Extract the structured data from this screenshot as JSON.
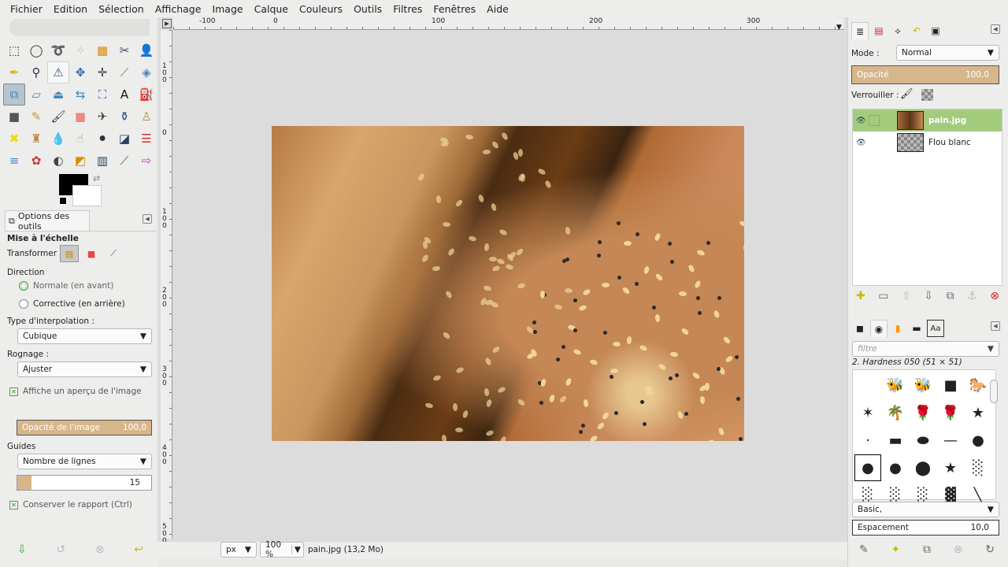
{
  "menu": [
    "Fichier",
    "Edition",
    "Sélection",
    "Affichage",
    "Image",
    "Calque",
    "Couleurs",
    "Outils",
    "Filtres",
    "Fenêtres",
    "Aide"
  ],
  "tools": [
    {
      "name": "rect-select",
      "g": "⬚",
      "c": "#333"
    },
    {
      "name": "ellipse-select",
      "g": "◯",
      "c": "#333"
    },
    {
      "name": "free-select",
      "g": "➰",
      "c": "#888"
    },
    {
      "name": "fuzzy-select",
      "g": "✧",
      "c": "#cc9"
    },
    {
      "name": "color-select",
      "g": "▦",
      "c": "#d80"
    },
    {
      "name": "scissors",
      "g": "✂",
      "c": "#446"
    },
    {
      "name": "foreground-select",
      "g": "👤",
      "c": "#36a"
    },
    {
      "name": "paths",
      "g": "✒",
      "c": "#cb0"
    },
    {
      "name": "color-picker",
      "g": "⚲",
      "c": "#235"
    },
    {
      "name": "measure",
      "g": "⚠",
      "c": "#357"
    },
    {
      "name": "move",
      "g": "✥",
      "c": "#36a"
    },
    {
      "name": "align",
      "g": "✛",
      "c": "#333"
    },
    {
      "name": "crop",
      "g": "⟋",
      "c": "#777"
    },
    {
      "name": "rotate",
      "g": "◈",
      "c": "#48b"
    },
    {
      "name": "scale",
      "g": "⧉",
      "c": "#38b"
    },
    {
      "name": "shear",
      "g": "▱",
      "c": "#48b"
    },
    {
      "name": "perspective",
      "g": "⏏",
      "c": "#48b"
    },
    {
      "name": "flip",
      "g": "⇆",
      "c": "#48b"
    },
    {
      "name": "cage",
      "g": "⛶",
      "c": "#36a"
    },
    {
      "name": "text",
      "g": "A",
      "c": "#111"
    },
    {
      "name": "bucket-fill",
      "g": "⛽",
      "c": "#666"
    },
    {
      "name": "blend",
      "g": "■",
      "c": "#555"
    },
    {
      "name": "pencil",
      "g": "✎",
      "c": "#c93"
    },
    {
      "name": "paintbrush",
      "g": "🖌",
      "c": "#333"
    },
    {
      "name": "eraser",
      "g": "■",
      "c": "#e88"
    },
    {
      "name": "airbrush",
      "g": "✈",
      "c": "#444"
    },
    {
      "name": "ink",
      "g": "⚱",
      "c": "#248"
    },
    {
      "name": "clone",
      "g": "♙",
      "c": "#b84"
    },
    {
      "name": "heal",
      "g": "✖",
      "c": "#ed0"
    },
    {
      "name": "perspective-clone",
      "g": "♜",
      "c": "#b84"
    },
    {
      "name": "blur",
      "g": "💧",
      "c": "#6af"
    },
    {
      "name": "smudge",
      "g": "☝",
      "c": "#c96"
    },
    {
      "name": "dodge-burn",
      "g": "⚫",
      "c": "#333"
    },
    {
      "name": "desaturate",
      "g": "◪",
      "c": "#246"
    },
    {
      "name": "color-balance",
      "g": "☰",
      "c": "#c33"
    },
    {
      "name": "hue-saturation",
      "g": "≡",
      "c": "#48c"
    },
    {
      "name": "colorize",
      "g": "✿",
      "c": "#c33"
    },
    {
      "name": "brightness-contrast",
      "g": "◐",
      "c": "#444"
    },
    {
      "name": "threshold",
      "g": "◩",
      "c": "#d80"
    },
    {
      "name": "levels",
      "g": "▥",
      "c": "#246"
    },
    {
      "name": "curves",
      "g": "⟋",
      "c": "#555"
    },
    {
      "name": "invert",
      "g": "⇨",
      "c": "#c3c"
    }
  ],
  "tool_options": {
    "tab_label": "Options des outils",
    "title": "Mise à l'échelle",
    "transform_label": "Transformer :",
    "direction_label": "Direction",
    "direction_normal": "Normale (en avant)",
    "direction_corrective": "Corrective (en arrière)",
    "interpolation_label": "Type d'interpolation :",
    "interpolation_value": "Cubique",
    "clipping_label": "Rognage :",
    "clipping_value": "Ajuster",
    "preview_label": "Affiche un aperçu de l'image",
    "image_opacity_label": "Opacité de l'image",
    "image_opacity_value": "100,0",
    "guides_label": "Guides",
    "guides_value": "Nombre de lignes",
    "lines_value": "15",
    "keep_ratio_label": "Conserver le rapport (Ctrl)"
  },
  "ruler_top": [
    "-100",
    "0",
    "100",
    "200",
    "300"
  ],
  "ruler_left": [
    "100",
    "0",
    "100",
    "200",
    "300",
    "400",
    "500"
  ],
  "status": {
    "unit": "px",
    "zoom": "100 %",
    "info": "pain.jpg (13,2 Mo)"
  },
  "layers_panel": {
    "mode_label": "Mode :",
    "mode_value": "Normal",
    "opacity_label": "Opacité",
    "opacity_value": "100,0",
    "lock_label": "Verrouiller :",
    "layers": [
      {
        "name": "pain.jpg",
        "selected": true
      },
      {
        "name": "Flou blanc",
        "selected": false
      }
    ]
  },
  "brushes_panel": {
    "filter_placeholder": "filtre",
    "brush_name": "2. Hardness 050 (51 × 51)",
    "tag_value": "Basic,",
    "spacing_label": "Espacement",
    "spacing_value": "10,0"
  },
  "brushes": [
    "",
    "🐝",
    "🐝",
    "■",
    "🐎",
    "✶",
    "🌴",
    "🌹",
    "🌹",
    "★",
    "·",
    "▬",
    "⬬",
    "—",
    "●",
    "●",
    "●",
    "⬤",
    "★",
    "░",
    "░",
    "░",
    "░",
    "▓",
    "╲"
  ]
}
